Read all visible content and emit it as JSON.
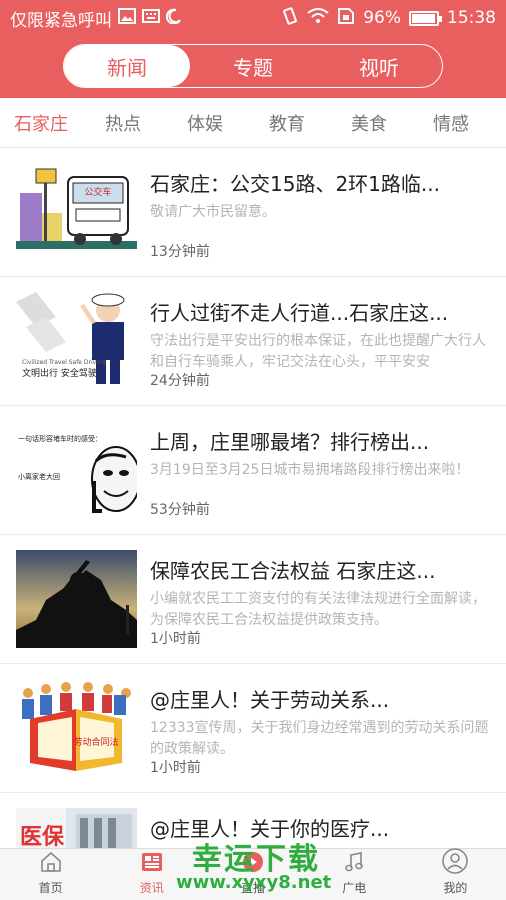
{
  "status_bar": {
    "carrier": "仅限紧急呼叫",
    "battery_percent": "96%",
    "battery_level": 0.96,
    "time": "15:38"
  },
  "header": {
    "tabs": [
      {
        "label": "新闻",
        "active": true
      },
      {
        "label": "专题",
        "active": false
      },
      {
        "label": "视听",
        "active": false
      }
    ]
  },
  "categories": [
    "石家庄",
    "热点",
    "体娱",
    "教育",
    "美食",
    "情感"
  ],
  "news": [
    {
      "title": "石家庄：公交15路、2环1路临...",
      "summary": "敬请广大市民留意。",
      "time": "13分钟前",
      "thumb_text": "公交车"
    },
    {
      "title": "行人过街不走人行道...石家庄这...",
      "summary": "守法出行是平安出行的根本保证，在此也提醒广大行人和自行车骑乘人，牢记交法在心头，平平安安",
      "time": "24分钟前",
      "thumb_text": "文明出行 安全驾驶",
      "thumb_text_en": "Civilized Travel Safe Driving"
    },
    {
      "title": "上周，庄里哪最堵？排行榜出...",
      "summary": "3月19日至3月25日城市易拥堵路段排行榜出来啦！",
      "time": "53分钟前",
      "thumb_text": "一句话形容堵车时的感受：",
      "thumb_text_2": "小离家老大回"
    },
    {
      "title": "保障农民工合法权益 石家庄这...",
      "summary": "小编就农民工工资支付的有关法律法规进行全面解读，为保障农民工合法权益提供政策支持。",
      "time": "1小时前"
    },
    {
      "title": "@庄里人！关于劳动关系...",
      "summary": "12333宣传周，关于我们身边经常遇到的劳动关系问题的政策解读。",
      "time": "1小时前",
      "thumb_text": "劳动合同法"
    },
    {
      "title": "@庄里人！关于你的医疗...",
      "summary": "",
      "time": "",
      "thumb_text": "医保"
    }
  ],
  "tabbar": [
    {
      "label": "首页",
      "icon": "home-icon",
      "active": false
    },
    {
      "label": "资讯",
      "icon": "news-icon",
      "active": true
    },
    {
      "label": "直播",
      "icon": "live-icon",
      "active": false
    },
    {
      "label": "广电",
      "icon": "music-icon",
      "active": false
    },
    {
      "label": "我的",
      "icon": "profile-icon",
      "active": false
    }
  ],
  "watermark": {
    "title": "幸运下载",
    "url": "www.xyxy8.net"
  },
  "colors": {
    "accent": "#e95f5f",
    "watermark": "#2fae3f"
  }
}
